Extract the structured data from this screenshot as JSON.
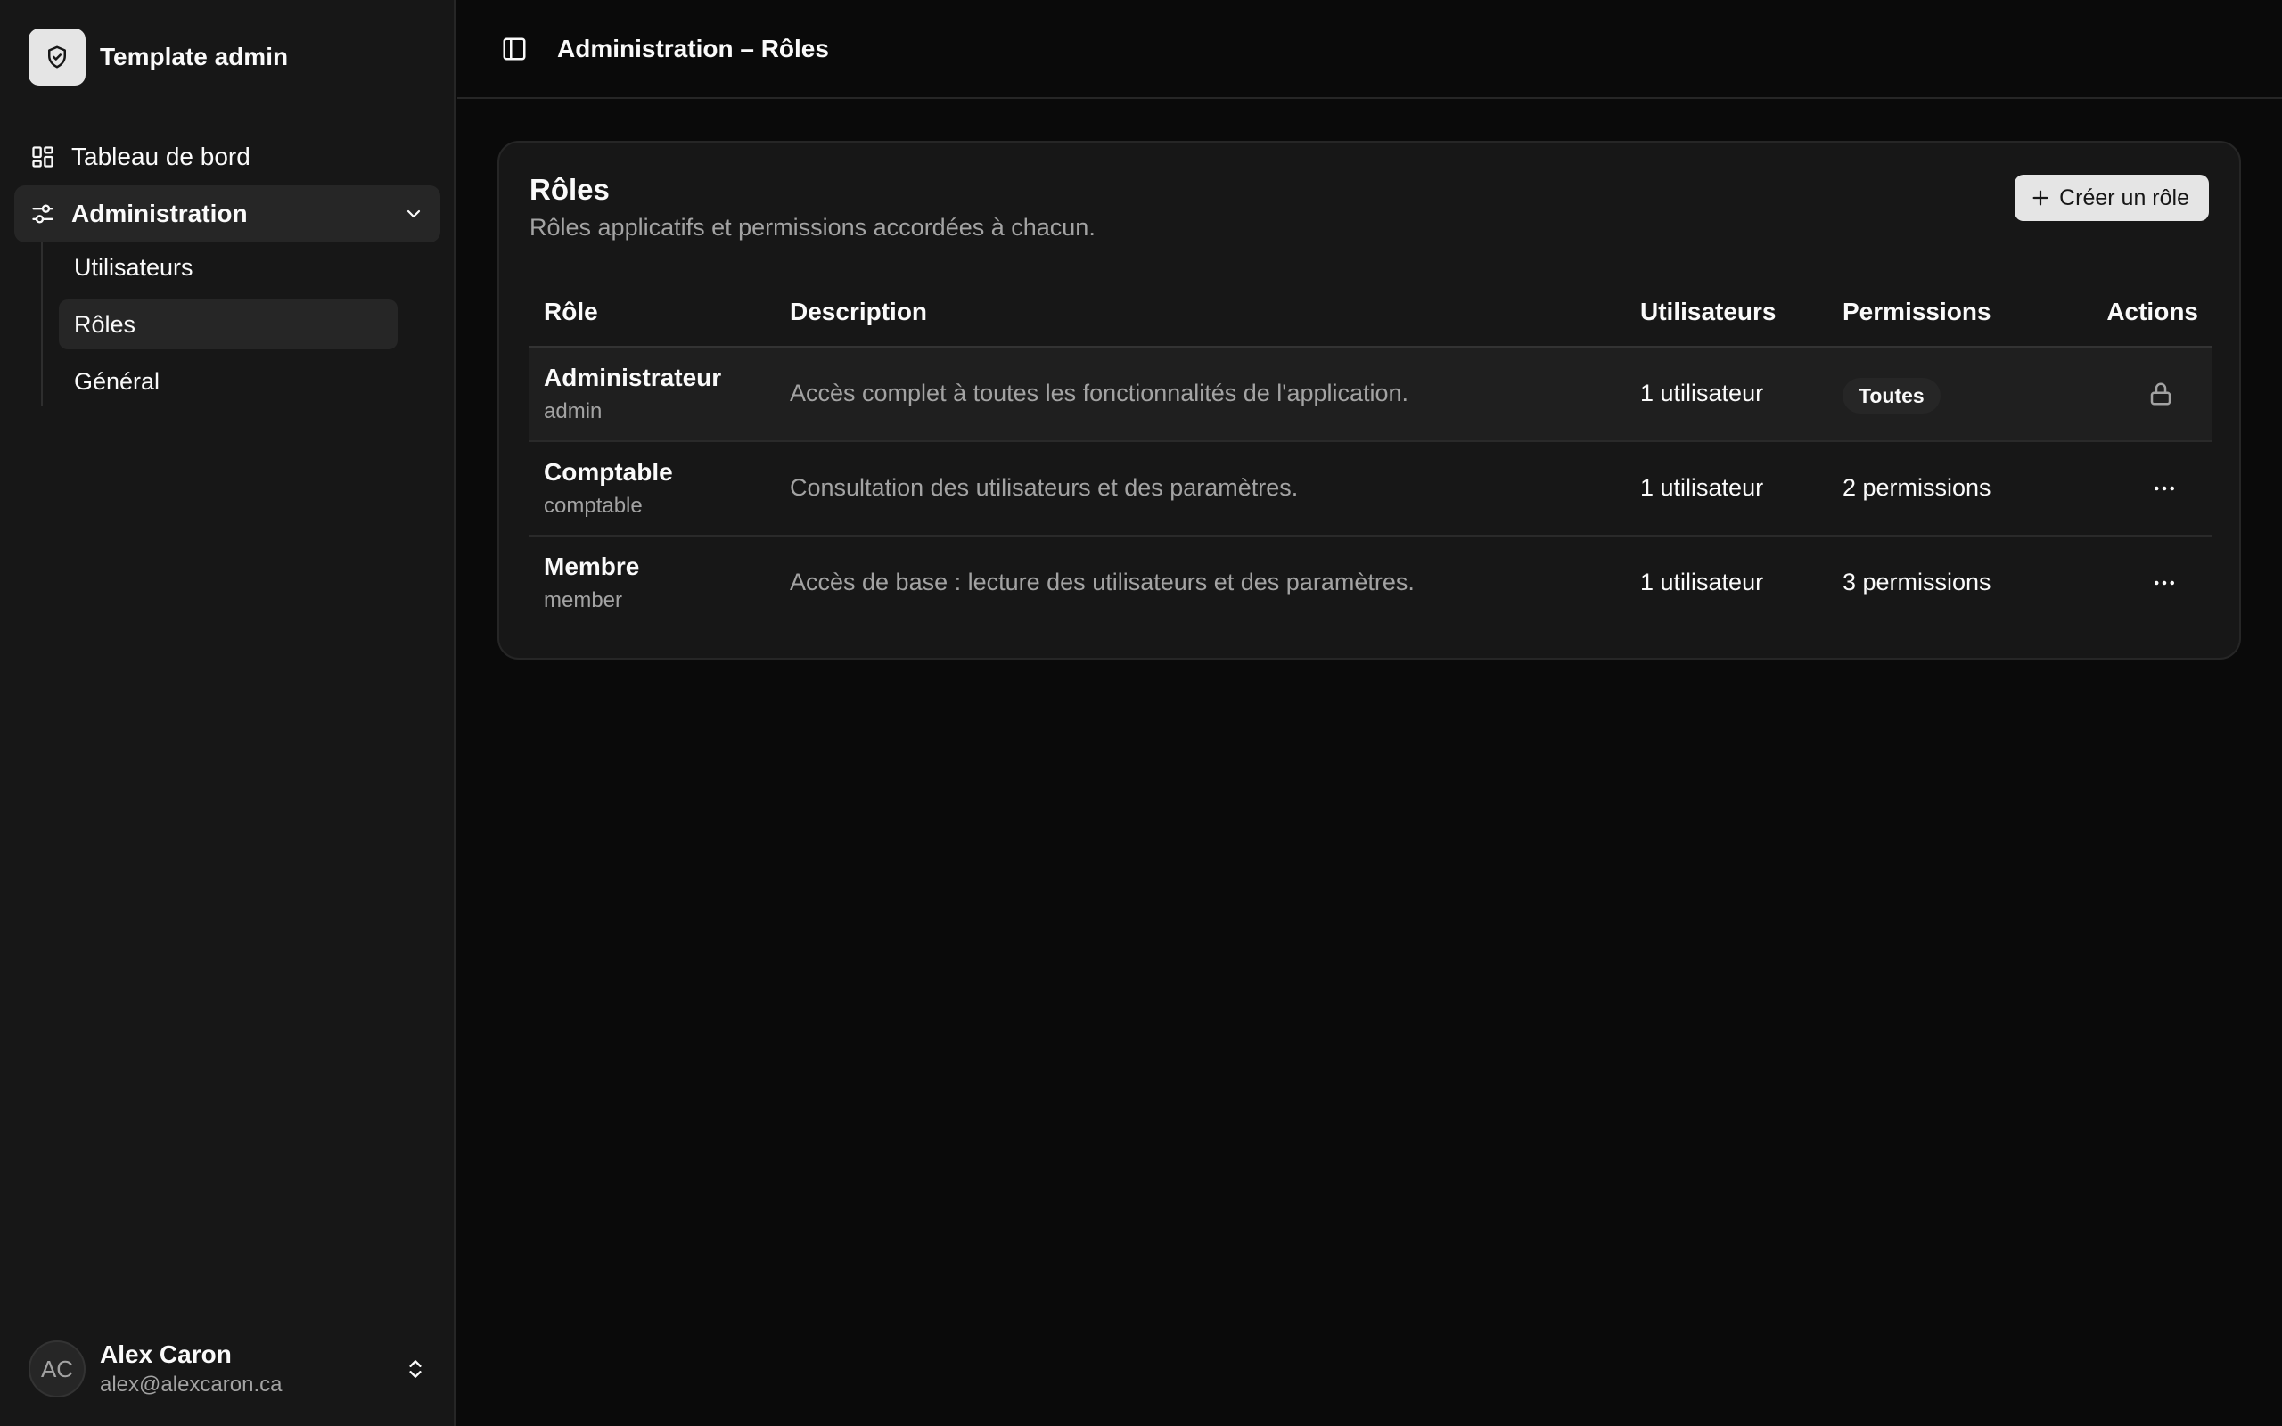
{
  "app": {
    "title": "Template admin"
  },
  "sidebar": {
    "nav": [
      {
        "label": "Tableau de bord",
        "icon": "dashboard-grid-icon"
      },
      {
        "label": "Administration",
        "icon": "sliders-icon",
        "expanded": true
      }
    ],
    "subnav": [
      {
        "label": "Utilisateurs",
        "active": false
      },
      {
        "label": "Rôles",
        "active": true
      },
      {
        "label": "Général",
        "active": false
      }
    ],
    "user": {
      "initials": "AC",
      "name": "Alex Caron",
      "email": "alex@alexcaron.ca"
    }
  },
  "header": {
    "title": "Administration – Rôles"
  },
  "card": {
    "title": "Rôles",
    "subtitle": "Rôles applicatifs et permissions accordées à chacun.",
    "create_label": "Créer un rôle"
  },
  "table": {
    "columns": [
      "Rôle",
      "Description",
      "Utilisateurs",
      "Permissions",
      "Actions"
    ],
    "rows": [
      {
        "name": "Administrateur",
        "key": "admin",
        "description": "Accès complet à toutes les fonctionnalités de l'application.",
        "users": "1 utilisateur",
        "permissions": "Toutes",
        "permissions_badge": true,
        "action": "lock-icon"
      },
      {
        "name": "Comptable",
        "key": "comptable",
        "description": "Consultation des utilisateurs et des paramètres.",
        "users": "1 utilisateur",
        "permissions": "2 permissions",
        "permissions_badge": false,
        "action": "more-horizontal-icon"
      },
      {
        "name": "Membre",
        "key": "member",
        "description": "Accès de base : lecture des utilisateurs et des paramètres.",
        "users": "1 utilisateur",
        "permissions": "3 permissions",
        "permissions_badge": false,
        "action": "more-horizontal-icon"
      }
    ]
  },
  "colors": {
    "background": "#0a0a0a",
    "sidebar": "#171717",
    "card": "#171717",
    "accent_button": "#e5e5e5",
    "muted_text": "#a3a3a3"
  }
}
